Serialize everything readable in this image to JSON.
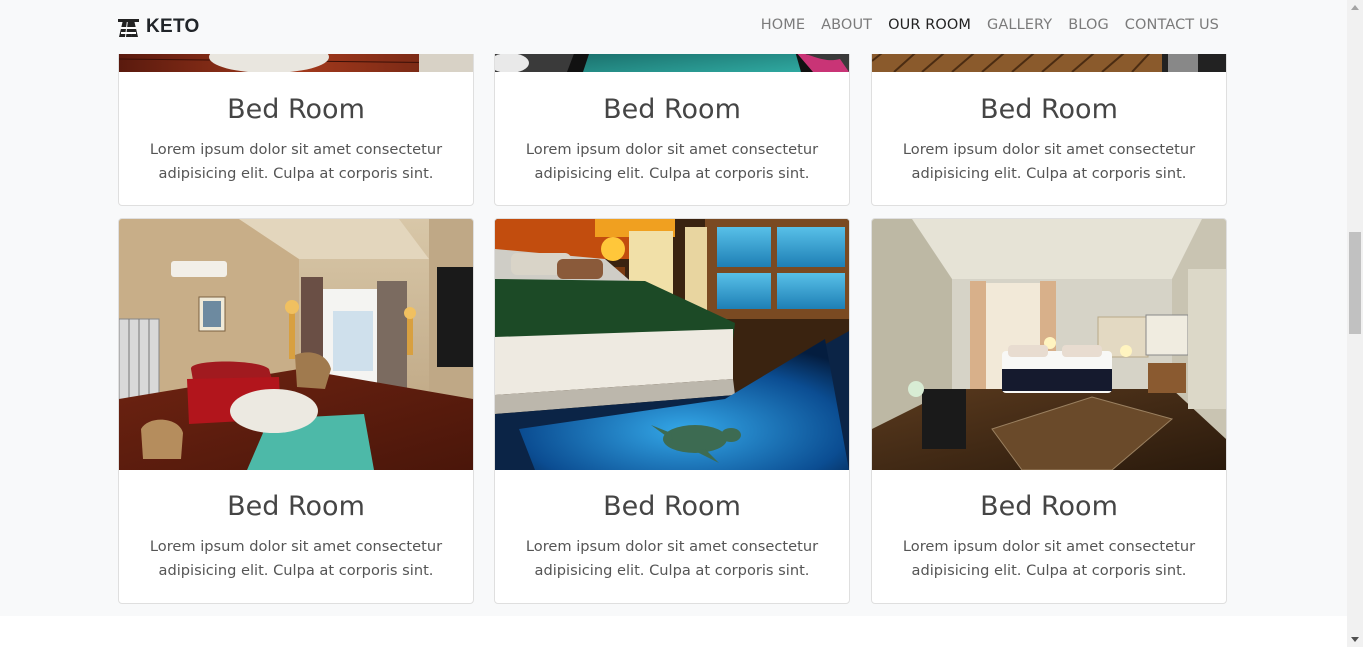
{
  "navbar": {
    "brand": "KETO",
    "brand_icon": "hotel-building-icon",
    "links": [
      {
        "label": "HOME",
        "active": false
      },
      {
        "label": "ABOUT",
        "active": false
      },
      {
        "label": "OUR ROOM",
        "active": true
      },
      {
        "label": "GALLERY",
        "active": false
      },
      {
        "label": "BLOG",
        "active": false
      },
      {
        "label": "CONTACT US",
        "active": false
      }
    ]
  },
  "rooms": [
    {
      "title": "Bed Room",
      "text_line1": "Lorem ipsum dolor sit amet consectetur",
      "text_line2": "adipisicing elit. Culpa at corporis sint.",
      "image": "living-room-photo"
    },
    {
      "title": "Bed Room",
      "text_line1": "Lorem ipsum dolor sit amet consectetur",
      "text_line2": "adipisicing elit. Culpa at corporis sint.",
      "image": "aquarium-floor-bedroom-photo"
    },
    {
      "title": "Bed Room",
      "text_line1": "Lorem ipsum dolor sit amet consectetur",
      "text_line2": "adipisicing elit. Culpa at corporis sint.",
      "image": "hotel-bedroom-photo"
    },
    {
      "title": "Bed Room",
      "text_line1": "Lorem ipsum dolor sit amet consectetur",
      "text_line2": "adipisicing elit. Culpa at corporis sint.",
      "image": "living-room-photo"
    },
    {
      "title": "Bed Room",
      "text_line1": "Lorem ipsum dolor sit amet consectetur",
      "text_line2": "adipisicing elit. Culpa at corporis sint.",
      "image": "aquarium-floor-bedroom-photo"
    },
    {
      "title": "Bed Room",
      "text_line1": "Lorem ipsum dolor sit amet consectetur",
      "text_line2": "adipisicing elit. Culpa at corporis sint.",
      "image": "hotel-bedroom-photo"
    }
  ],
  "colors": {
    "page_background": "#f8f9fa",
    "card_border": "#dfdfdf",
    "nav_text": "#7b7b7b",
    "nav_active": "#222222"
  }
}
